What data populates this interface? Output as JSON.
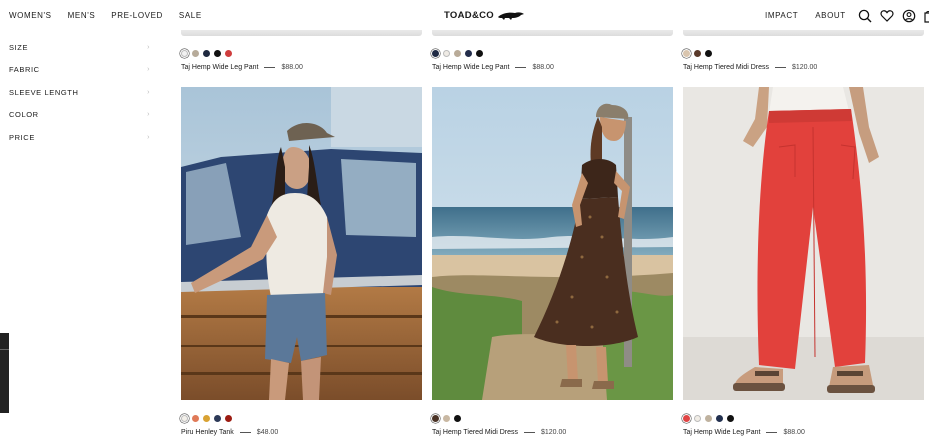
{
  "header": {
    "nav_left": [
      "WOMEN'S",
      "MEN'S",
      "PRE-LOVED",
      "SALE"
    ],
    "logo": "TOAD&CO",
    "nav_right": [
      "IMPACT",
      "ABOUT"
    ],
    "icons": [
      "search-icon",
      "heart-icon",
      "account-icon",
      "cart-icon"
    ]
  },
  "sidebar": {
    "filters": [
      "SIZE",
      "FABRIC",
      "SLEEVE LENGTH",
      "COLOR",
      "PRICE"
    ]
  },
  "products_top": [
    {
      "name": "Taj Hemp Wide Leg Pant",
      "price": "$88.00",
      "swatches": [
        "#f2f2f2",
        "#b7ab9a",
        "#1f2940",
        "#111111",
        "#cf3d3d"
      ],
      "selected": 0
    },
    {
      "name": "Taj Hemp Wide Leg Pant",
      "price": "$88.00",
      "swatches": [
        "#1f2a44",
        "#efebe5",
        "#b9ab98",
        "#232d4b",
        "#111111"
      ],
      "selected": 0
    },
    {
      "name": "Taj Hemp Tiered Midi Dress",
      "price": "$120.00",
      "swatches": [
        "#d9c5ae",
        "#5a3a2a",
        "#111111"
      ],
      "selected": 0
    }
  ],
  "products_bottom": [
    {
      "name": "Piru Henley Tank",
      "price": "$48.00",
      "swatches": [
        "#f3f0ea",
        "#e07a58",
        "#d9a233",
        "#2d3a58",
        "#9c1c12"
      ],
      "selected": 0,
      "image": "woman-in-tank-and-denim-shorts-by-truck"
    },
    {
      "name": "Taj Hemp Tiered Midi Dress",
      "price": "$120.00",
      "swatches": [
        "#4a3326",
        "#c9b8a3",
        "#111111"
      ],
      "selected": 0,
      "image": "woman-in-brown-floral-dress-on-beach"
    },
    {
      "name": "Taj Hemp Wide Leg Pant",
      "price": "$88.00",
      "swatches": [
        "#df4444",
        "#f1ede6",
        "#bfb29f",
        "#22304f",
        "#111111"
      ],
      "selected": 0,
      "image": "red-wide-leg-pants-and-sandals"
    }
  ]
}
